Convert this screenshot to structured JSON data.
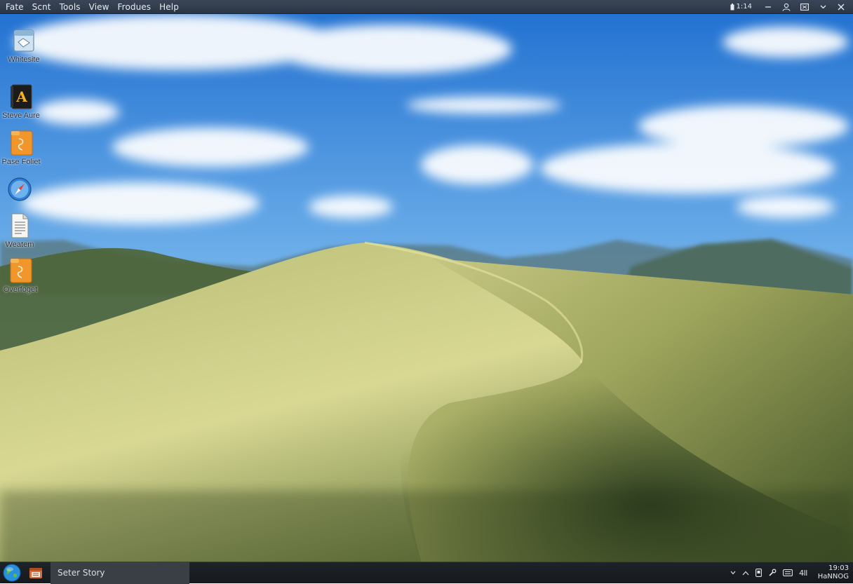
{
  "menubar": {
    "menus": [
      "Fate",
      "Scnt",
      "Tools",
      "View",
      "Frodues",
      "Help"
    ],
    "status_text": "1:14"
  },
  "desktop": {
    "icons": [
      {
        "label": "Whitesite",
        "icon": "document-window-icon"
      },
      {
        "label": "Steve Aure",
        "icon": "app-letter-a-icon"
      },
      {
        "label": "Pase Foliet",
        "icon": "orange-folder-icon"
      },
      {
        "label": "",
        "icon": "compass-browser-icon"
      },
      {
        "label": "Weatem",
        "icon": "text-document-icon"
      },
      {
        "label": "Overfoget",
        "icon": "orange-folder-icon"
      }
    ]
  },
  "taskbar": {
    "task_label": "Seter Story",
    "tray_signal": "4ll",
    "clock_time": "19:03",
    "clock_date": "HaNNOG"
  },
  "colors": {
    "menubar": "#2f3a4b",
    "taskbar": "#1a1e23",
    "task_button": "#3a3f46",
    "folder_orange": "#f0962a"
  }
}
